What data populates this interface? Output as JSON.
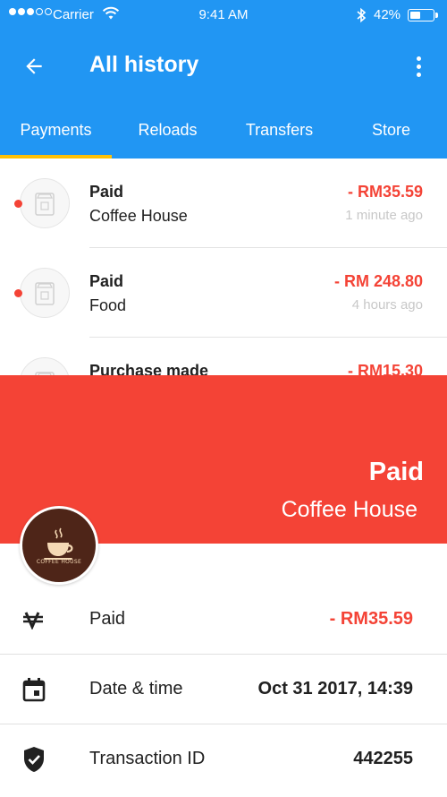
{
  "status_bar": {
    "carrier": "Carrier",
    "time": "9:41 AM",
    "battery": "42%",
    "battery_level": 0.42
  },
  "toolbar": {
    "title": "All history",
    "back_icon": "arrow-left-icon",
    "menu_icon": "more-vert-icon"
  },
  "tabs": [
    {
      "label": "Payments",
      "active": true
    },
    {
      "label": "Reloads",
      "active": false
    },
    {
      "label": "Transfers",
      "active": false
    },
    {
      "label": "Store",
      "active": false
    }
  ],
  "transactions": [
    {
      "status": "Paid",
      "merchant": "Coffee House",
      "amount": "- RM35.59",
      "time_ago": "1 minute ago",
      "unread": true,
      "icon": "store-icon"
    },
    {
      "status": "Paid",
      "merchant": "Food",
      "amount": "- RM 248.80",
      "time_ago": "4 hours ago",
      "unread": true,
      "icon": "store-icon"
    },
    {
      "status": "Purchase made",
      "merchant": "",
      "amount": "- RM15.30",
      "time_ago": "",
      "unread": false,
      "icon": "store-icon"
    }
  ],
  "detail": {
    "header_status": "Paid",
    "header_merchant": "Coffee House",
    "header_color": "#F44336",
    "merchant_logo_text": "COFFEE HOUSE",
    "rows": [
      {
        "icon": "currency-icon",
        "label": "Paid",
        "value": "- RM35.59"
      },
      {
        "icon": "calendar-icon",
        "label": "Date & time",
        "value": "Oct 31 2017, 14:39"
      },
      {
        "icon": "shield-check-icon",
        "label": "Transaction ID",
        "value": "442255"
      }
    ]
  },
  "colors": {
    "primary": "#2196F3",
    "tab_indicator": "#FFC107",
    "negative": "#F44336"
  }
}
